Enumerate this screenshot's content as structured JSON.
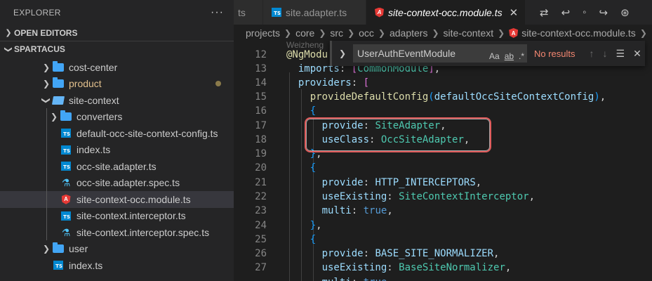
{
  "sidebar": {
    "title": "EXPLORER",
    "more": "···",
    "sections": {
      "open_editors": "OPEN EDITORS",
      "workspace": "SPARTACUS"
    },
    "items": [
      {
        "label": "cost-center",
        "type": "folder",
        "level": 1,
        "expanded": false
      },
      {
        "label": "product",
        "type": "folder",
        "level": 1,
        "expanded": false,
        "modified": true
      },
      {
        "label": "site-context",
        "type": "folder",
        "level": 1,
        "expanded": true
      },
      {
        "label": "converters",
        "type": "folder",
        "level": 2,
        "expanded": false
      },
      {
        "label": "default-occ-site-context-config.ts",
        "type": "ts",
        "level": 2
      },
      {
        "label": "index.ts",
        "type": "ts",
        "level": 2
      },
      {
        "label": "occ-site.adapter.ts",
        "type": "ts",
        "level": 2
      },
      {
        "label": "occ-site.adapter.spec.ts",
        "type": "spec",
        "level": 2
      },
      {
        "label": "site-context-occ.module.ts",
        "type": "angular",
        "level": 2,
        "selected": true
      },
      {
        "label": "site-context.interceptor.ts",
        "type": "ts",
        "level": 2
      },
      {
        "label": "site-context.interceptor.spec.ts",
        "type": "spec",
        "level": 2
      },
      {
        "label": "user",
        "type": "folder",
        "level": 1,
        "expanded": false
      },
      {
        "label": "index.ts",
        "type": "ts",
        "level": 1
      }
    ]
  },
  "tabs": [
    {
      "label": "ts",
      "icon": "none"
    },
    {
      "label": "site.adapter.ts",
      "icon": "ts-icon"
    },
    {
      "label": "site-context-occ.module.ts",
      "icon": "angular-icon",
      "active": true,
      "close": "✕"
    }
  ],
  "breadcrumb": [
    "projects",
    "core",
    "src",
    "occ",
    "adapters",
    "site-context",
    "site-context-occ.module.ts",
    "..."
  ],
  "find_widget": {
    "query": "UserAuthEventModule",
    "match_case": "Aa",
    "whole_word": "ab",
    "regex": ".*",
    "status": "No results"
  },
  "code_peek": "Weizheng",
  "line_numbers": [
    "12",
    "13",
    "14",
    "15",
    "16",
    "17",
    "18",
    "19",
    "20",
    "21",
    "22",
    "23",
    "24",
    "25",
    "26",
    "27"
  ],
  "code": {
    "l12_dec": "@NgModu",
    "l13_key": "imports",
    "l13_val": "CommonModule",
    "l14_key": "providers",
    "l15_fn": "provideDefaultConfig",
    "l15_arg": "defaultOccSiteContextConfig",
    "l17_key": "provide",
    "l17_val": "SiteAdapter",
    "l18_key": "useClass",
    "l18_val": "OccSiteAdapter",
    "l21_key": "provide",
    "l21_val": "HTTP_INTERCEPTORS",
    "l22_key": "useExisting",
    "l22_val": "SiteContextInterceptor",
    "l23_key": "multi",
    "l23_val": "true",
    "l26_key": "provide",
    "l26_val": "BASE_SITE_NORMALIZER",
    "l27_key": "useExisting",
    "l27_val": "BaseSiteNormalizer",
    "l28_key": "multi",
    "l28_val": "true"
  }
}
